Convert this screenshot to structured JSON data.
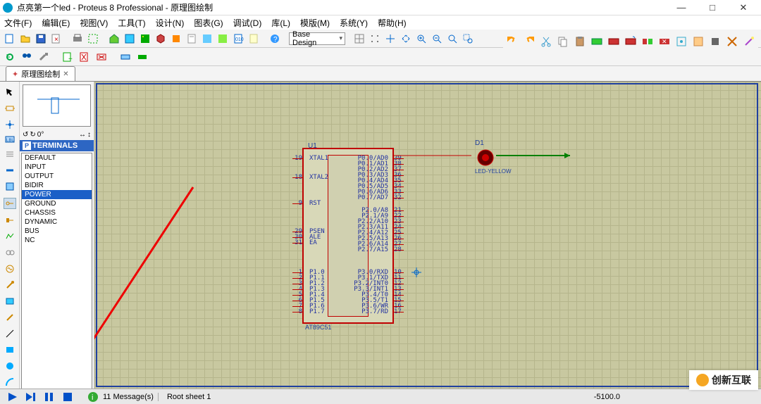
{
  "window": {
    "title": "点亮第一个led - Proteus 8 Professional - 原理图绘制",
    "min": "—",
    "max": "□",
    "close": "✕"
  },
  "menus": [
    "文件(F)",
    "编辑(E)",
    "视图(V)",
    "工具(T)",
    "设计(N)",
    "图表(G)",
    "调试(D)",
    "库(L)",
    "模版(M)",
    "系统(Y)",
    "帮助(H)"
  ],
  "design_combo": "Base Design",
  "tab": {
    "label": "原理图绘制",
    "close": "✕"
  },
  "rotation": "0°",
  "palette": {
    "title": "TERMINALS",
    "items": [
      "DEFAULT",
      "INPUT",
      "OUTPUT",
      "BIDIR",
      "POWER",
      "GROUND",
      "CHASSIS",
      "DYNAMIC",
      "BUS",
      "NC"
    ],
    "selected": "POWER"
  },
  "schematic": {
    "u1": {
      "ref": "U1",
      "part": "AT89C51",
      "left_pins": [
        {
          "n": "19",
          "lbl": "XTAL1"
        },
        {
          "n": "18",
          "lbl": "XTAL2"
        },
        {
          "n": "9",
          "lbl": "RST"
        },
        {
          "n": "29",
          "lbl": "PSEN"
        },
        {
          "n": "30",
          "lbl": "ALE"
        },
        {
          "n": "31",
          "lbl": "EA"
        },
        {
          "n": "1",
          "lbl": "P1.0"
        },
        {
          "n": "2",
          "lbl": "P1.1"
        },
        {
          "n": "3",
          "lbl": "P1.2"
        },
        {
          "n": "4",
          "lbl": "P1.3"
        },
        {
          "n": "5",
          "lbl": "P1.4"
        },
        {
          "n": "6",
          "lbl": "P1.5"
        },
        {
          "n": "7",
          "lbl": "P1.6"
        },
        {
          "n": "8",
          "lbl": "P1.7"
        }
      ],
      "right_pins": [
        {
          "lbl": "P0.0/AD0",
          "n": "39"
        },
        {
          "lbl": "P0.1/AD1",
          "n": "38"
        },
        {
          "lbl": "P0.2/AD2",
          "n": "37"
        },
        {
          "lbl": "P0.3/AD3",
          "n": "36"
        },
        {
          "lbl": "P0.4/AD4",
          "n": "35"
        },
        {
          "lbl": "P0.5/AD5",
          "n": "34"
        },
        {
          "lbl": "P0.6/AD6",
          "n": "33"
        },
        {
          "lbl": "P0.7/AD7",
          "n": "32"
        },
        {
          "lbl": "P2.0/A8",
          "n": "21"
        },
        {
          "lbl": "P2.1/A9",
          "n": "22"
        },
        {
          "lbl": "P2.2/A10",
          "n": "23"
        },
        {
          "lbl": "P2.3/A11",
          "n": "24"
        },
        {
          "lbl": "P2.4/A12",
          "n": "25"
        },
        {
          "lbl": "P2.5/A13",
          "n": "26"
        },
        {
          "lbl": "P2.6/A14",
          "n": "27"
        },
        {
          "lbl": "P2.7/A15",
          "n": "28"
        },
        {
          "lbl": "P3.0/RXD",
          "n": "10"
        },
        {
          "lbl": "P3.1/TXD",
          "n": "11"
        },
        {
          "lbl": "P3.2/INT0",
          "n": "12"
        },
        {
          "lbl": "P3.3/INT1",
          "n": "13"
        },
        {
          "lbl": "P3.4/T0",
          "n": "14"
        },
        {
          "lbl": "P3.5/T1",
          "n": "15"
        },
        {
          "lbl": "P3.6/WR",
          "n": "16"
        },
        {
          "lbl": "P3.7/RD",
          "n": "17"
        }
      ]
    },
    "d1": {
      "ref": "D1",
      "label": "LED-YELLOW"
    }
  },
  "status": {
    "messages": "11 Message(s)",
    "sheet": "Root sheet 1",
    "coord": "-5100.0"
  },
  "watermark": "创新互联"
}
